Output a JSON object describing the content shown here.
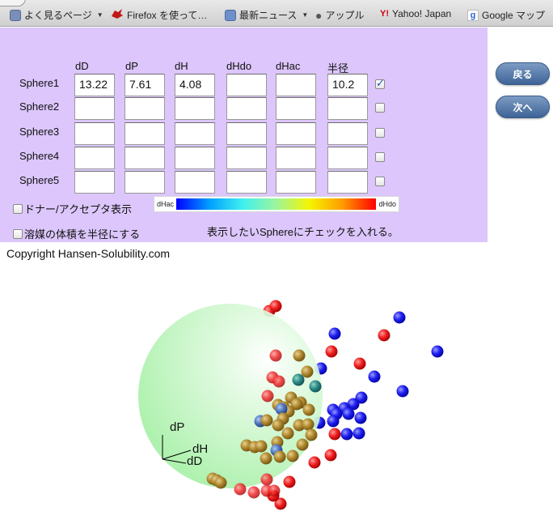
{
  "bookmarks": [
    {
      "label": "よく見るページ",
      "icon": "folder-icon",
      "dropdown": true
    },
    {
      "label": "Firefox を使って…",
      "icon": "firefox-icon",
      "dropdown": false
    },
    {
      "label": "最新ニュース",
      "icon": "rss-icon",
      "dropdown": true
    },
    {
      "label": "アップル",
      "icon": "apple-icon",
      "dropdown": false
    },
    {
      "label": "Yahoo! Japan",
      "icon": "yahoo-icon",
      "dropdown": false
    },
    {
      "label": "Google マップ",
      "icon": "google-icon",
      "dropdown": false
    }
  ],
  "table": {
    "columns": [
      "dD",
      "dP",
      "dH",
      "dHdo",
      "dHac",
      "半径"
    ],
    "rows": [
      {
        "label": "Sphere1",
        "values": [
          "13.22",
          "7.61",
          "4.08",
          "",
          "",
          "10.2"
        ],
        "checked": true
      },
      {
        "label": "Sphere2",
        "values": [
          "",
          "",
          "",
          "",
          "",
          ""
        ],
        "checked": false
      },
      {
        "label": "Sphere3",
        "values": [
          "",
          "",
          "",
          "",
          "",
          ""
        ],
        "checked": false
      },
      {
        "label": "Sphere4",
        "values": [
          "",
          "",
          "",
          "",
          "",
          ""
        ],
        "checked": false
      },
      {
        "label": "Sphere5",
        "values": [
          "",
          "",
          "",
          "",
          "",
          ""
        ],
        "checked": false
      }
    ]
  },
  "options": {
    "donor_acceptor_label": "ドナー/アクセプタ表示",
    "solvent_volume_label": "溶媒の体積を半径にする"
  },
  "gradient": {
    "left_label": "dHac",
    "right_label": "dHdo"
  },
  "hint": "表示したいSphereにチェックを入れる。",
  "buttons": {
    "back": "戻る",
    "next": "次へ"
  },
  "copyright": "Copyright Hansen-Solubility.com",
  "axes": {
    "y": "dP",
    "z": "dH",
    "x": "dD"
  },
  "colors": {
    "panel": "#dcc6fb",
    "sphere": "#b8f5b8",
    "red": "#e01010",
    "blue": "#1818e0",
    "olive": "#a08030"
  }
}
